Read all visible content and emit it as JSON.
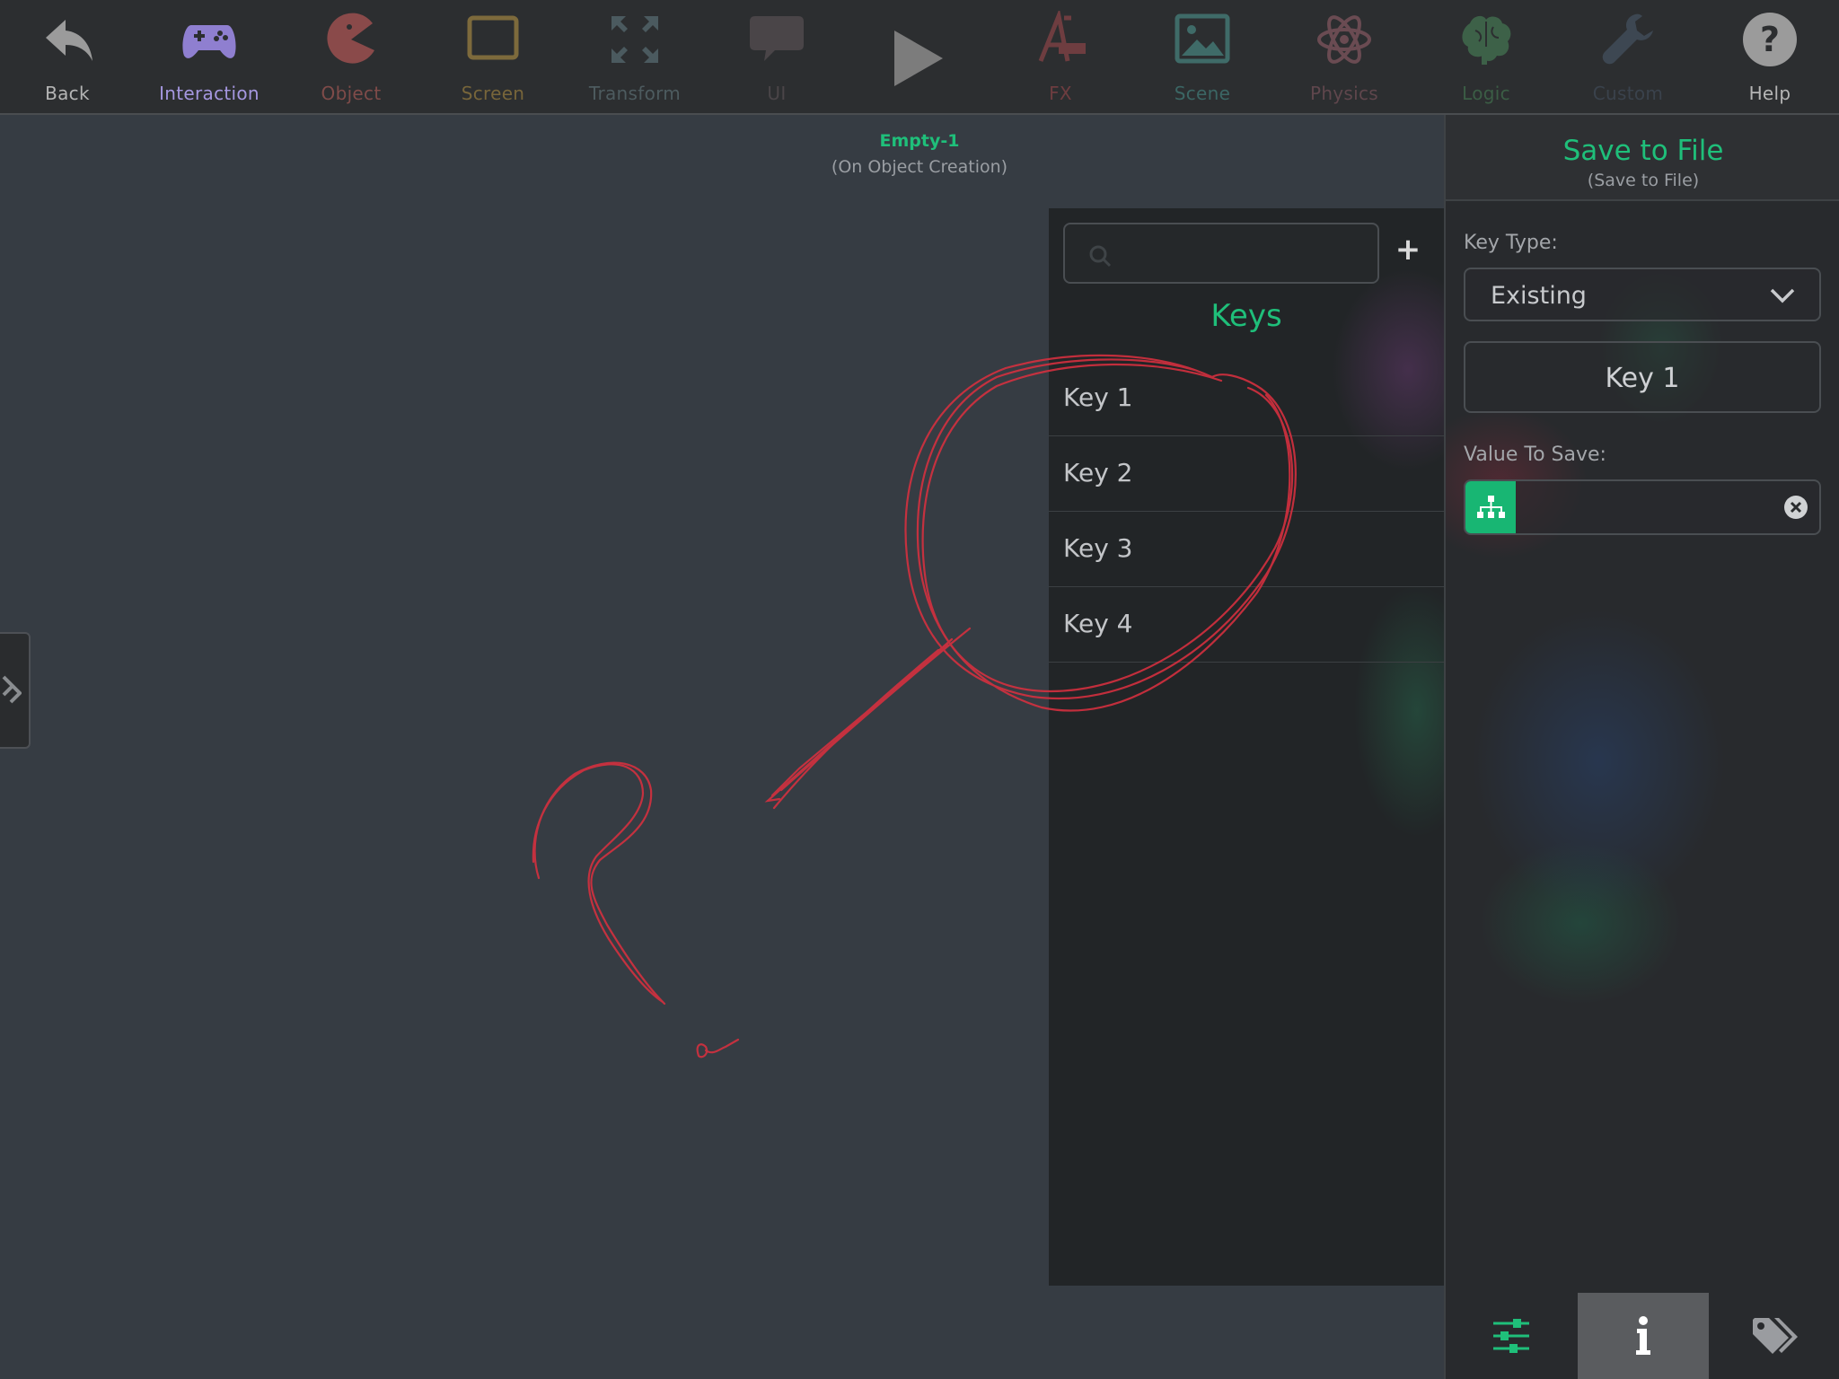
{
  "toolbar": {
    "items": [
      {
        "label": "Back",
        "icon": "back-arrow-icon",
        "color": "#9b9b9b"
      },
      {
        "label": "Interaction",
        "icon": "gamepad-icon",
        "color": "#8f7fd0"
      },
      {
        "label": "Object",
        "icon": "pacman-icon",
        "color": "#8a4a4a"
      },
      {
        "label": "Screen",
        "icon": "screen-icon",
        "color": "#7d6a3c"
      },
      {
        "label": "Transform",
        "icon": "transform-arrows-icon",
        "color": "#4b5a5f"
      },
      {
        "label": "UI",
        "icon": "speech-bubble-icon",
        "color": "#4a4548"
      },
      {
        "label": "FX",
        "icon": "fx-icon",
        "color": "#6e3d40"
      },
      {
        "label": "Scene",
        "icon": "image-icon",
        "color": "#3f6b68"
      },
      {
        "label": "Physics",
        "icon": "atom-icon",
        "color": "#6a4b52"
      },
      {
        "label": "Logic",
        "icon": "brain-icon",
        "color": "#3d6148"
      },
      {
        "label": "Custom",
        "icon": "wrench-icon",
        "color": "#3d4752"
      },
      {
        "label": "Help",
        "icon": "help-icon",
        "color": "#9b9b9b"
      }
    ],
    "play_icon": "play-icon"
  },
  "canvas": {
    "title": "Empty-1",
    "subtitle": "(On Object Creation)"
  },
  "keys_panel": {
    "search_placeholder": "",
    "add_label": "+",
    "heading": "Keys",
    "keys": [
      "Key 1",
      "Key 2",
      "Key 3",
      "Key 4"
    ]
  },
  "inspector": {
    "title": "Save to File",
    "subtitle": "(Save to File)",
    "key_type_label": "Key Type:",
    "key_type_value": "Existing",
    "key_name": "Key 1",
    "value_label": "Value To Save:",
    "value": ""
  },
  "tabs": {
    "items": [
      {
        "icon": "sliders-icon",
        "active": false
      },
      {
        "icon": "info-icon",
        "active": true
      },
      {
        "icon": "tags-icon",
        "active": false
      }
    ]
  },
  "colors": {
    "accent": "#1fbf7a",
    "annotation": "#d4303f",
    "canvas_bg": "#363c43"
  }
}
